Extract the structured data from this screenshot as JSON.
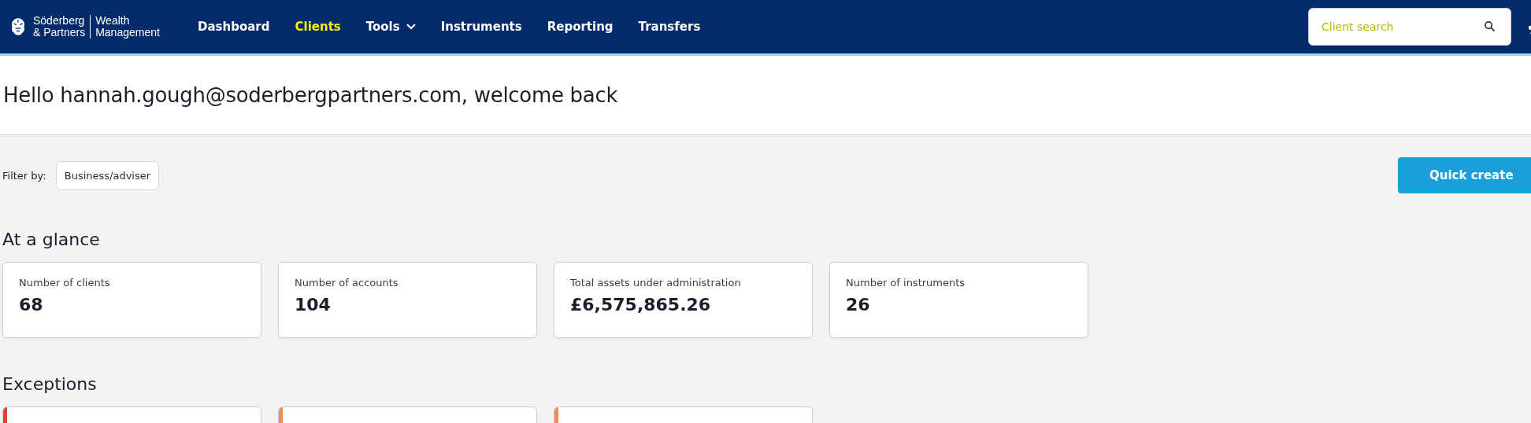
{
  "header": {
    "logo": {
      "brand_line_1": "Söderberg",
      "brand_line_2": "& Partners",
      "product_line_1": "Wealth",
      "product_line_2": "Management"
    },
    "nav": [
      {
        "label": "Dashboard",
        "selected": false,
        "dropdown": false
      },
      {
        "label": "Clients",
        "selected": true,
        "dropdown": false
      },
      {
        "label": "Tools",
        "selected": false,
        "dropdown": true
      },
      {
        "label": "Instruments",
        "selected": false,
        "dropdown": false
      },
      {
        "label": "Reporting",
        "selected": false,
        "dropdown": false
      },
      {
        "label": "Transfers",
        "selected": false,
        "dropdown": false
      }
    ],
    "search": {
      "placeholder": "Client search"
    }
  },
  "greeting": "Hello hannah.gough@soderbergpartners.com, welcome back",
  "filter": {
    "label": "Filter by:",
    "button": "Business/adviser"
  },
  "quick_create": "Quick create",
  "at_a_glance": {
    "title": "At a glance",
    "cards": [
      {
        "label": "Number of clients",
        "value": "68"
      },
      {
        "label": "Number of accounts",
        "value": "104"
      },
      {
        "label": "Total assets under administration",
        "value": "£6,575,865.26"
      },
      {
        "label": "Number of instruments",
        "value": "26"
      }
    ]
  },
  "exceptions": {
    "title": "Exceptions",
    "cards": [
      {
        "color": "#d9473a"
      },
      {
        "color": "#f08a5d"
      },
      {
        "color": "#f08a5d"
      }
    ]
  }
}
